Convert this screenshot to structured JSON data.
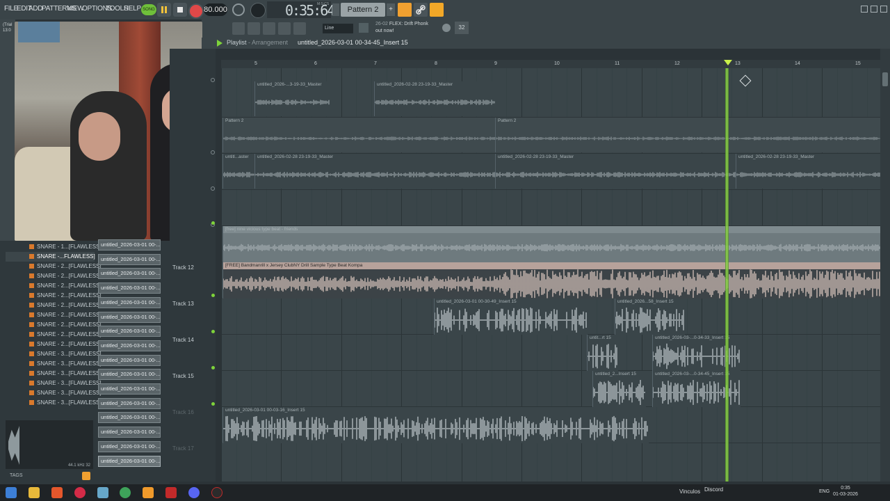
{
  "menu": [
    "FILE",
    "EDIT",
    "ADD",
    "PATTERNS",
    "VIEW",
    "OPTIONS",
    "TOOLS",
    "HELP"
  ],
  "transport": {
    "mode": "SONG",
    "tempo": "80.000",
    "time": "0:35:64",
    "time_unit": "M:S:CS",
    "pattern": "Pattern 2",
    "pattern_add": "+"
  },
  "toolbar2": {
    "snap": "Line",
    "news_date": "26-02",
    "news_title": "FLEX: Drift Phonk",
    "news_sub": "out now!",
    "cpu_label": "32"
  },
  "left": {
    "trial": "(Trial",
    "trial_time": "13:0"
  },
  "playlist": {
    "title": "Playlist",
    "title_sep": " - ",
    "title_view": "Arrangement",
    "song": "untitled_2026-03-01 00-34-45_Insert 15",
    "ruler": [
      "5",
      "6",
      "7",
      "8",
      "9",
      "10",
      "11",
      "12",
      "13",
      "14",
      "15"
    ]
  },
  "browser": {
    "items": [
      "SNARE - 1...[FLAWLESS]",
      "SNARE -...FLAWLESS]",
      "SNARE - 2...[FLAWLESS]",
      "SNARE - 2...[FLAWLESS]",
      "SNARE - 2...[FLAWLESS]",
      "SNARE - 2...[FLAWLESS]",
      "SNARE - 2...[FLAWLESS]",
      "SNARE - 2...[FLAWLESS]",
      "SNARE - 2...[FLAWLESS]",
      "SNARE - 2...[FLAWLESS]",
      "SNARE - 2...[FLAWLESS]",
      "SNARE - 3...[FLAWLESS]",
      "SNARE - 3...[FLAWLESS]",
      "SNARE - 3...[FLAWLESS]",
      "SNARE - 3...[FLAWLESS]",
      "SNARE - 3...[FLAWLESS]",
      "SNARE - 3...[FLAWLESS]"
    ],
    "renders": [
      "untitled_2026-03-01 00-...",
      "untitled_2026-03-01 00-...",
      "untitled_2026-03-01 00-...",
      "untitled_2026-03-01 00-...",
      "untitled_2026-03-01 00-...",
      "untitled_2026-03-01 00-...",
      "untitled_2026-03-01 00-...",
      "untitled_2026-03-01 00-...",
      "untitled_2026-03-01 00-...",
      "untitled_2026-03-01 00-...",
      "untitled_2026-03-01 00-...",
      "untitled_2026-03-01 00-...",
      "untitled_2026-03-01 00-...",
      "untitled_2026-03-01 00-...",
      "untitled_2026-03-01 00-...",
      "untitled_2026-03-01 00-..."
    ],
    "preview_info": "44.1 kHz 32",
    "tags": "TAGS"
  },
  "tracks": {
    "t12": "Track 12",
    "t13": "Track 13",
    "t14": "Track 14",
    "t15": "Track 15",
    "t16": "Track 16",
    "t17": "Track 17"
  },
  "clips": {
    "c1": "untitled_2026-...3-19-33_Master",
    "c2": "untitled_2026-02-28 23-19-33_Master",
    "c3": "Pattern 2",
    "c4": "Pattern 2",
    "c5": "untitl...aster",
    "c6": "untitled_2026-02-28 23-19-33_Master",
    "c7": "untitled_2026-02-28 23-19-33_Master",
    "c8": "untitled_2026-02-28 23-19-33_Master",
    "c9": "[free] nine vicious type beat - friends",
    "c10": "[FREE] Bandmanrill x Jersey ClubNY Drill Sample Type Beat Kompa",
    "c11": "untitled_2026-03-01 00-30-49_Insert 15",
    "c12": "untitled_2026...58_Insert 15",
    "c13": "untit...rt 15",
    "c14": "untitled_2026-03-...0-34-33_Insert 15",
    "c15": "untitled_2...Insert 15",
    "c16": "untitled_2026-03-...0-34-45_Insert 15",
    "c17": "untitled_2026-03-01 00-03-16_Insert 15"
  },
  "taskbar": {
    "vinculos": "Vinculos",
    "discord": "Discord",
    "lang": "ENG",
    "time": "0:35",
    "date": "01-03-2026"
  },
  "colors": {
    "accent_green": "#7ed33a",
    "playhead": "#9ce64d",
    "record": "#e04848",
    "orange": "#f0a030",
    "sample_clip": "#d9c3b8"
  },
  "icons": [
    "pause-icon",
    "stop-icon",
    "record-icon",
    "metronome-icon",
    "link-icon",
    "globe-icon",
    "search-icon",
    "folder-icon"
  ]
}
